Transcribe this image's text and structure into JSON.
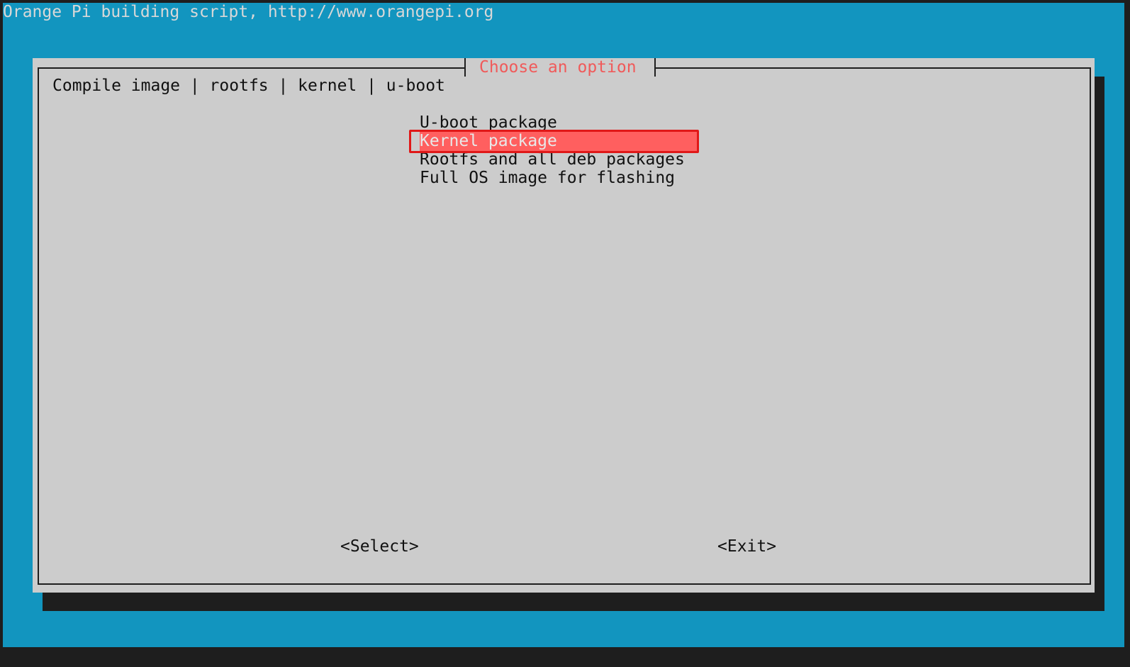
{
  "screen_title": "Orange Pi building script, http://www.orangepi.org",
  "dialog": {
    "title": "Choose an option",
    "subtitle": "Compile image | rootfs | kernel | u-boot",
    "options": [
      {
        "label": "U-boot package",
        "selected": false
      },
      {
        "label": "Kernel package",
        "selected": true
      },
      {
        "label": "Rootfs and all deb packages",
        "selected": false
      },
      {
        "label": "Full OS image for flashing",
        "selected": false
      }
    ],
    "buttons": {
      "select": "<Select>",
      "exit": "<Exit>"
    }
  },
  "colors": {
    "background": "#1295bf",
    "dialog": "#cccccc",
    "highlight": "#ff5f5f",
    "title": "#f05a5a"
  }
}
